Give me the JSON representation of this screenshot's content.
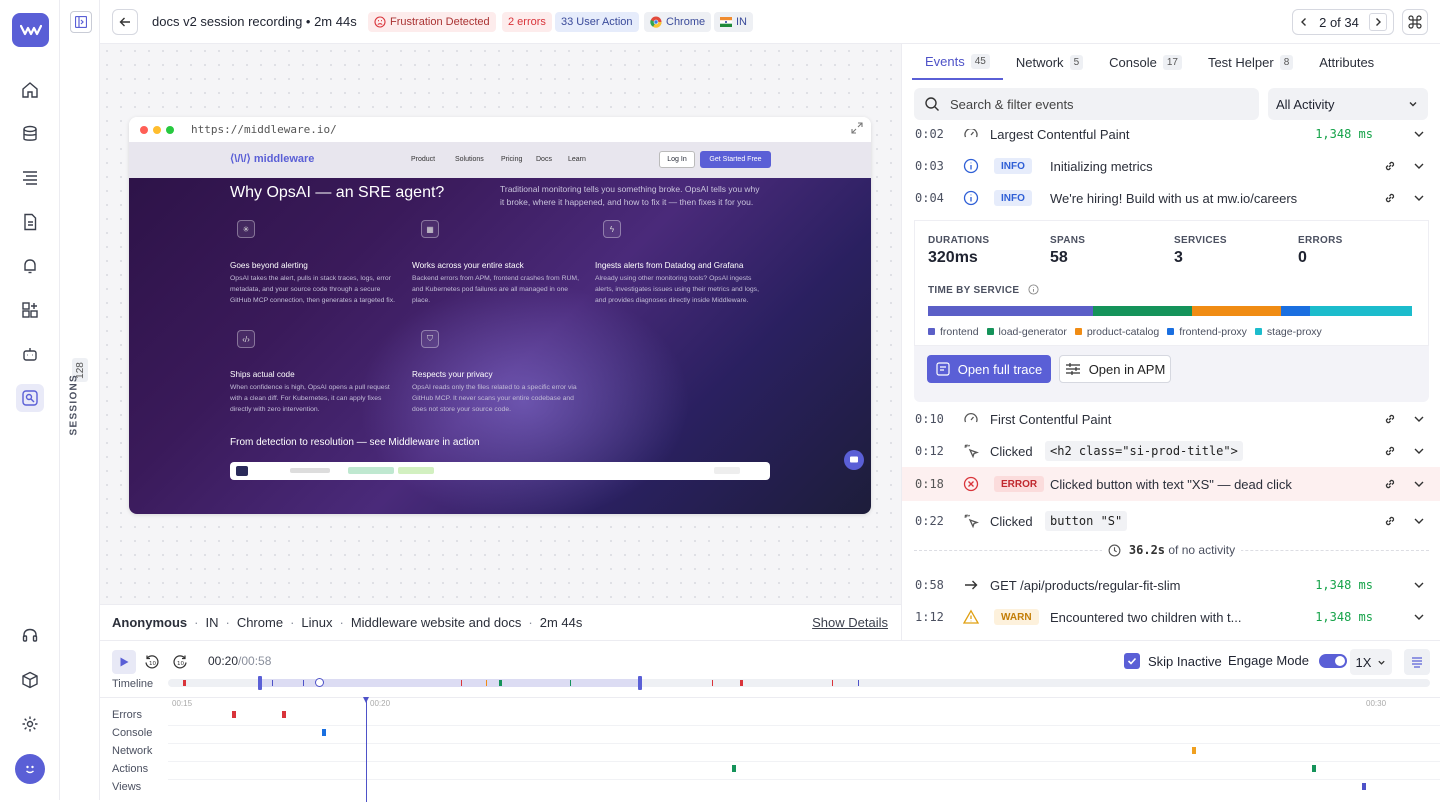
{
  "session": {
    "title": "docs v2 session recording • 2m 44s",
    "chips": {
      "frustration": "Frustration Detected",
      "errors": "2 errors",
      "user_action": "33 User Action",
      "browser": "Chrome",
      "country": "IN"
    },
    "pager": "2 of 34"
  },
  "sidebar": {
    "sessions_label": "SESSIONS",
    "sessions_count": "128",
    "icons": [
      "home-icon",
      "infra-icon",
      "logs-icon",
      "documents-icon",
      "alerts-icon",
      "dashboards-icon",
      "ai-bot-icon",
      "session-replay-icon",
      "support-icon",
      "packages-icon",
      "settings-icon"
    ]
  },
  "replay": {
    "url": "https://middleware.io/",
    "site": {
      "logo": "middleware",
      "nav": [
        "Product",
        "Solutions",
        "Pricing",
        "Docs",
        "Learn"
      ],
      "login": "Log In",
      "cta": "Get Started Free",
      "headline": "Why OpsAI — an SRE agent?",
      "lead": "Traditional monitoring tells you something broke. OpsAI tells you why it broke, where it happened, and how to fix it — then fixes it for you.",
      "features": [
        {
          "title": "Goes beyond alerting",
          "desc": "OpsAI takes the alert, pulls in stack traces, logs, error metadata, and your source code through a secure GitHub MCP connection, then generates a targeted fix."
        },
        {
          "title": "Works across your entire stack",
          "desc": "Backend errors from APM, frontend crashes from RUM, and Kubernetes pod failures are all managed in one place."
        },
        {
          "title": "Ingests alerts from Datadog and Grafana",
          "desc": "Already using other monitoring tools? OpsAI ingests alerts, investigates issues using their metrics and logs, and provides diagnoses directly inside Middleware."
        },
        {
          "title": "Ships actual code",
          "desc": "When confidence is high, OpsAI opens a pull request with a clean diff. For Kubernetes, it can apply fixes directly with zero intervention."
        },
        {
          "title": "Respects your privacy",
          "desc": "OpsAI reads only the files related to a specific error via GitHub MCP. It never scans your entire codebase and does not store your source code."
        }
      ],
      "section2": "From detection to resolution — see Middleware in action"
    }
  },
  "meta": {
    "user": "Anonymous",
    "country": "IN",
    "browser": "Chrome",
    "os": "Linux",
    "app": "Middleware website and docs",
    "duration": "2m 44s",
    "show_details": "Show Details"
  },
  "panel": {
    "tabs": [
      {
        "label": "Events",
        "count": "45"
      },
      {
        "label": "Network",
        "count": "5"
      },
      {
        "label": "Console",
        "count": "17"
      },
      {
        "label": "Test Helper",
        "count": "8"
      },
      {
        "label": "Attributes",
        "count": ""
      }
    ],
    "search_placeholder": "Search & filter events",
    "filter": "All Activity",
    "events": [
      {
        "time": "0:02",
        "label": "Largest Contentful Paint",
        "duration": "1,348 ms"
      },
      {
        "time": "0:03",
        "badge": "INFO",
        "label": "Initializing metrics"
      },
      {
        "time": "0:04",
        "badge": "INFO",
        "label": "We're hiring! Build with us at mw.io/careers"
      },
      {
        "time": "0:10",
        "label": "First Contentful Paint"
      },
      {
        "time": "0:12",
        "label": "Clicked",
        "code": "<h2 class=\"si-prod-title\">"
      },
      {
        "time": "0:18",
        "badge": "ERROR",
        "label": "Clicked button with text \"XS\" — dead click"
      },
      {
        "time": "0:22",
        "label": "Clicked",
        "code": "button \"S\""
      },
      {
        "time": "0:58",
        "label": "GET /api/products/regular-fit-slim",
        "duration": "1,348 ms"
      },
      {
        "time": "1:12",
        "badge": "WARN",
        "label": "Encountered two children with t...",
        "duration": "1,348 ms"
      }
    ],
    "detail": {
      "durations_k": "DURATIONS",
      "durations_v": "320ms",
      "spans_k": "SPANS",
      "spans_v": "58",
      "services_k": "SERVICES",
      "services_v": "3",
      "errors_k": "ERRORS",
      "errors_v": "0",
      "tbs": "TIME BY SERVICE",
      "services": [
        {
          "name": "frontend",
          "color": "#5b5fc7",
          "share": 0.34
        },
        {
          "name": "load-generator",
          "color": "#15935a",
          "share": 0.205
        },
        {
          "name": "product-catalog",
          "color": "#f08c14",
          "share": 0.185
        },
        {
          "name": "frontend-proxy",
          "color": "#1a6fe0",
          "share": 0.06
        },
        {
          "name": "stage-proxy",
          "color": "#1cbccc",
          "share": 0.21
        }
      ],
      "open_trace": "Open full trace",
      "open_apm": "Open in APM"
    },
    "inactivity": "36.2s",
    "inactivity_suffix": "of no activity"
  },
  "player": {
    "current": "00:20",
    "total": "/00:58",
    "skip_inactive": "Skip Inactive",
    "engage_mode": "Engage Mode",
    "speed": "1X",
    "timeline_label": "Timeline",
    "ticks": [
      "00:15",
      "00:20",
      "00:30"
    ],
    "lanes": [
      "Errors",
      "Console",
      "Network",
      "Actions",
      "Views"
    ],
    "colors": {
      "error": "#d9343a",
      "console": "#1a6fe0",
      "network": "#f0a020",
      "actions": "#15935a",
      "views": "#4e52c8"
    }
  }
}
